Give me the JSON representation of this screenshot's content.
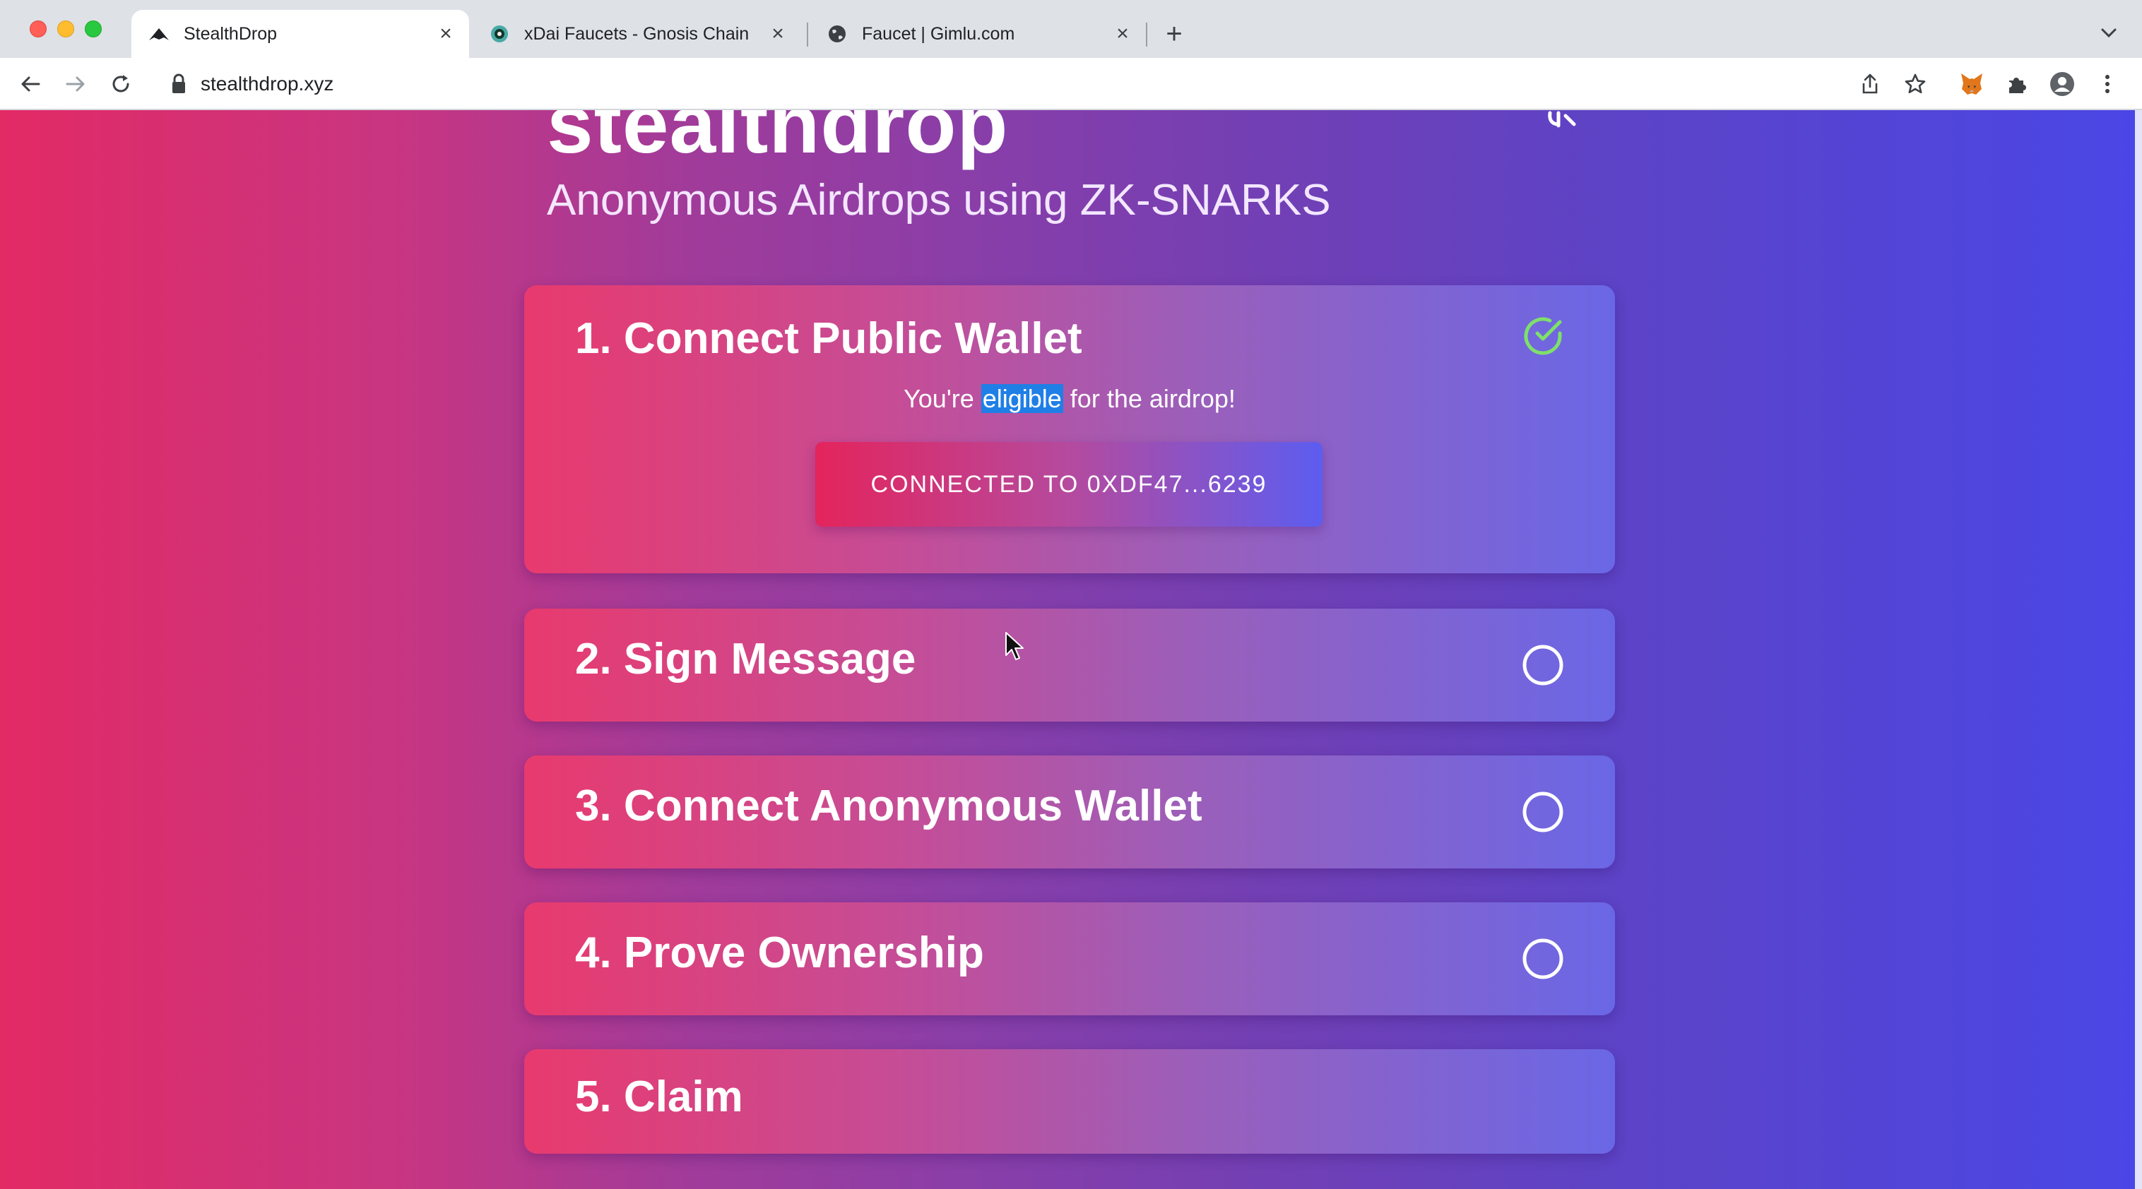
{
  "browser": {
    "tabs": [
      {
        "title": "StealthDrop",
        "favicon": "stealth-favicon",
        "active": true
      },
      {
        "title": "xDai Faucets - Gnosis Chain",
        "favicon": "gnosis-favicon",
        "active": false
      },
      {
        "title": "Faucet | Gimlu.com",
        "favicon": "globe-favicon",
        "active": false
      }
    ],
    "new_tab_label": "+",
    "close_label": "×",
    "url": "stealthdrop.xyz"
  },
  "page": {
    "title": "stealthdrop",
    "subtitle": "Anonymous Airdrops using ZK-SNARKS",
    "steps": [
      {
        "label": "1. Connect Public Wallet",
        "status": "complete"
      },
      {
        "label": "2. Sign Message",
        "status": "pending"
      },
      {
        "label": "3. Connect Anonymous Wallet",
        "status": "pending"
      },
      {
        "label": "4. Prove Ownership",
        "status": "pending"
      },
      {
        "label": "5. Claim",
        "status": "none"
      }
    ],
    "eligibility": {
      "prefix": "You're ",
      "highlight": "eligible",
      "suffix": " for the airdrop!"
    },
    "connected_button_label": "CONNECTED TO 0XDF47...6239"
  },
  "colors": {
    "check_green": "#7ee06a",
    "selection_blue": "#1f7fe6",
    "gradient_left": "#e22a65",
    "gradient_right": "#4a46e6"
  }
}
